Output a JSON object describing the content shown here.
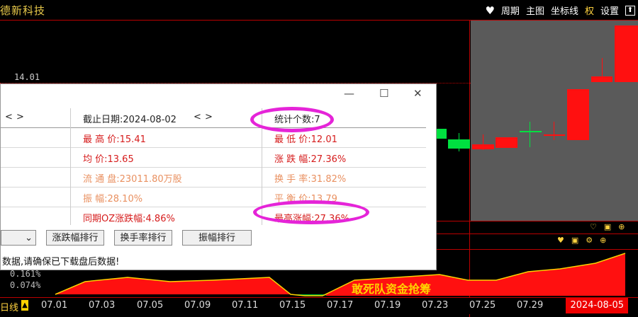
{
  "header": {
    "stock_name": "德新科技",
    "menu": [
      {
        "label": "周期"
      },
      {
        "label": "主图"
      },
      {
        "label": "坐标线"
      },
      {
        "label": "权"
      },
      {
        "label": "设置"
      }
    ]
  },
  "chart": {
    "price_label": "14.01",
    "volume_pct_1": "0.161%",
    "volume_pct_2": "0.074%",
    "slogan": "敢死队资金抢筹",
    "period_label": "日线",
    "dates": [
      "07.01",
      "07.03",
      "07.05",
      "07.09",
      "07.11",
      "07.15",
      "07.17",
      "07.19",
      "07.23",
      "07.25",
      "07.29"
    ],
    "end_date": "2024-08-05",
    "colors": {
      "up": "#ff1010",
      "down": "#00e040",
      "shade": "#5a5a5a"
    }
  },
  "dialog": {
    "nav_prev": "<",
    "nav_next": ">",
    "end_date": "截止日期:2024-08-02",
    "stat_count": "统计个数:7",
    "max_price": "最 高 价:15.41",
    "min_price": "最 低 价:12.01",
    "avg_price": "均    价:13.65",
    "change": "涨 跌 幅:27.36%",
    "float_shares": "流 通 盘:23011.80万股",
    "turnover": "换 手 率:31.82%",
    "amplitude": "振    幅:28.10%",
    "balance_price": "平 衡 价:13.79",
    "oz_change": "同期OZ涨跌幅:4.86%",
    "max_gain": "最高涨幅:27.36%",
    "buttons": {
      "rank_change": "涨跌幅排行",
      "rank_turnover": "换手率排行",
      "rank_amplitude": "振幅排行"
    },
    "note": "数据,请确保已下载盘后数据!"
  }
}
